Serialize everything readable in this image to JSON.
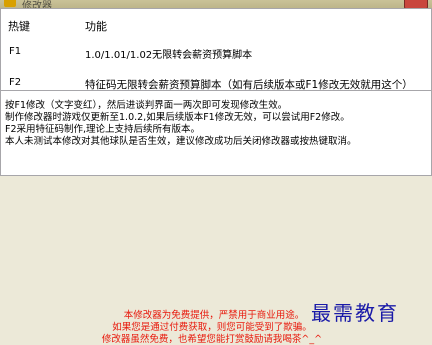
{
  "window": {
    "title": "修改器"
  },
  "table": {
    "headers": {
      "key": "热键",
      "func": "功能"
    },
    "rows": [
      {
        "key": "F1",
        "func": "1.0/1.01/1.02无限转会薪资预算脚本"
      },
      {
        "key": "F2",
        "func": "特征码无限转会薪资预算脚本（如有后续版本或F1修改无效就用这个）"
      }
    ]
  },
  "info": {
    "lines": [
      "按F1修改（文字变红），然后进谈判界面一两次即可发现修改生效。",
      "制作修改器时游戏仅更新至1.0.2,如果后续版本F1修改无效，可以尝试用F2修改。",
      "F2采用特征码制作,理论上支持后续所有版本。",
      "本人未测试本修改对其他球队是否生效，建议修改成功后关闭修改器或按热键取消。"
    ]
  },
  "notice": {
    "lines": [
      "本修改器为免费提供，严禁用于商业用途。",
      "如果您是通过付费获取，则您可能受到了欺骗。",
      "修改器虽然免费，也希望您能打赏鼓励请我喝茶^_^"
    ],
    "color": "#e8190c"
  },
  "watermark": {
    "text": "最需教育"
  }
}
